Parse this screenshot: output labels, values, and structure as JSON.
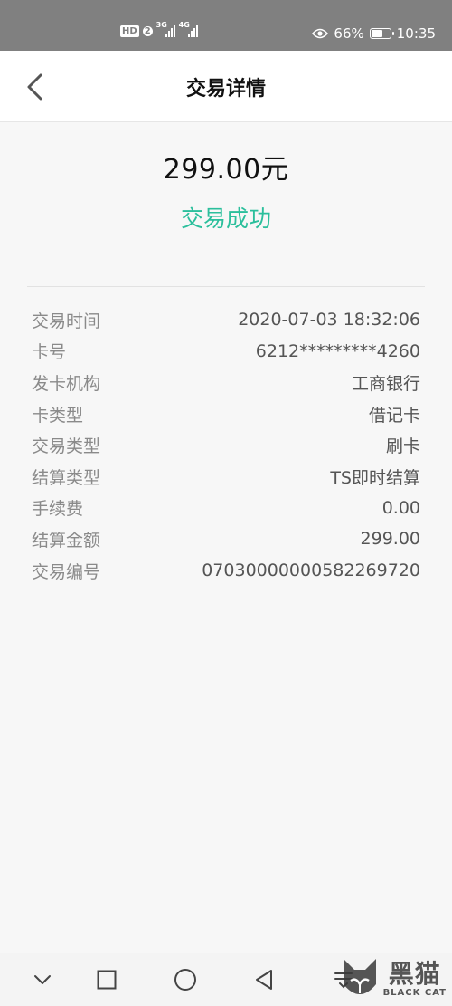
{
  "status_bar": {
    "hd": "HD",
    "sim": "2",
    "net1": "3G",
    "net2": "4G",
    "battery_pct": "66%",
    "battery_level": 0.66,
    "time": "10:35"
  },
  "header": {
    "title": "交易详情"
  },
  "summary": {
    "amount": "299.00元",
    "status": "交易成功",
    "status_color": "#2bbf9c"
  },
  "details": [
    {
      "label": "交易时间",
      "value": "2020-07-03 18:32:06"
    },
    {
      "label": "卡号",
      "value": "6212*********4260"
    },
    {
      "label": "发卡机构",
      "value": "工商银行"
    },
    {
      "label": "卡类型",
      "value": "借记卡"
    },
    {
      "label": "交易类型",
      "value": "刷卡"
    },
    {
      "label": "结算类型",
      "value": "TS即时结算"
    },
    {
      "label": "手续费",
      "value": "0.00"
    },
    {
      "label": "结算金额",
      "value": "299.00"
    },
    {
      "label": "交易编号",
      "value": "07030000000582269720"
    }
  ],
  "watermark": {
    "cn": "黑猫",
    "en": "BLACK CAT"
  },
  "icons": {
    "back": "chevron-left-icon",
    "eye": "eye-icon",
    "battery": "battery-icon",
    "nav_down": "chevron-down-icon",
    "nav_square": "square-icon",
    "nav_circle": "circle-icon",
    "nav_triangle": "triangle-back-icon",
    "logo": "cat-logo-icon"
  }
}
